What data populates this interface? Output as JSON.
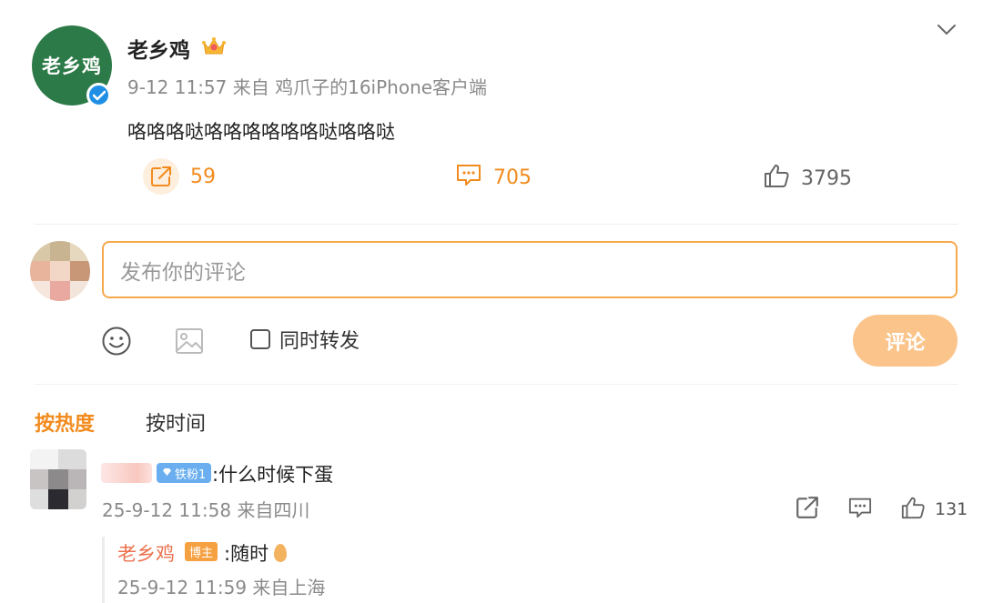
{
  "post": {
    "avatar_text": "老乡鸡",
    "author": "老乡鸡",
    "meta": "9-12 11:57 来自 鸡爪子的16iPhone客户端",
    "text": "咯咯咯哒咯咯咯咯咯咯哒咯咯哒",
    "repost_count": "59",
    "comment_count": "705",
    "like_count": "3795"
  },
  "composer": {
    "placeholder": "发布你的评论",
    "repost_label": "同时转发",
    "submit_label": "评论"
  },
  "sort": {
    "hot_label": "按热度",
    "time_label": "按时间"
  },
  "comment": {
    "fan_badge": "铁粉1",
    "text": ":什么时候下蛋",
    "meta": "25-9-12 11:58 来自四川",
    "like_count": "131"
  },
  "reply": {
    "author": "老乡鸡",
    "badge": "博主",
    "text": ":随时",
    "meta": "25-9-12 11:59 来自上海"
  },
  "colors": {
    "accent": "#f28b1e",
    "brand_green": "#2c7a47",
    "verified_blue": "#1e8fe5",
    "input_border": "#f6a94c",
    "submit_bg": "#fbc48b",
    "reply_name": "#eb7350"
  },
  "icons": {
    "crown": "crown-icon",
    "verified": "verified-icon",
    "chevron": "chevron-down-icon",
    "repost": "repost-icon",
    "comment": "comment-icon",
    "like": "thumbs-up-icon",
    "emoji": "emoji-icon",
    "image": "image-icon",
    "egg": "egg-icon"
  }
}
